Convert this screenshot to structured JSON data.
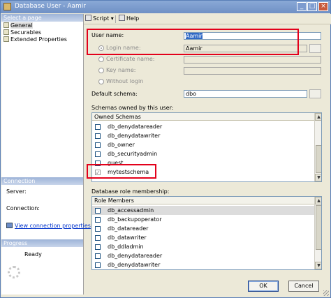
{
  "window": {
    "title": "Database User - Aamir"
  },
  "left": {
    "select_page_header": "Select a page",
    "pages": [
      {
        "label": "General",
        "selected": true
      },
      {
        "label": "Securables",
        "selected": false
      },
      {
        "label": "Extended Properties",
        "selected": false
      }
    ],
    "connection_header": "Connection",
    "server_label": "Server:",
    "connection_label": "Connection:",
    "view_connection_link": "View connection properties",
    "progress_header": "Progress",
    "progress_status": "Ready"
  },
  "toolbar": {
    "script_label": "Script",
    "help_label": "Help"
  },
  "form": {
    "user_name_label": "User name:",
    "user_name_value": "Aamir",
    "login_name_label": "Login name:",
    "login_name_value": "Aamir",
    "certificate_name_label": "Certificate name:",
    "key_name_label": "Key name:",
    "without_login_label": "Without login",
    "default_schema_label": "Default schema:",
    "default_schema_value": "dbo",
    "schemas_section_label": "Schemas owned by this user:",
    "owned_schemas_header": "Owned Schemas",
    "schemas": [
      {
        "name": "db_denydatareader",
        "checked": false
      },
      {
        "name": "db_denydatawriter",
        "checked": false
      },
      {
        "name": "db_owner",
        "checked": false
      },
      {
        "name": "db_securityadmin",
        "checked": false
      },
      {
        "name": "guest",
        "checked": false
      },
      {
        "name": "mytestschema",
        "checked": true
      }
    ],
    "roles_section_label": "Database role membership:",
    "role_members_header": "Role Members",
    "roles": [
      {
        "name": "db_accessadmin",
        "checked": false
      },
      {
        "name": "db_backupoperator",
        "checked": false
      },
      {
        "name": "db_datareader",
        "checked": false
      },
      {
        "name": "db_datawriter",
        "checked": false
      },
      {
        "name": "db_ddladmin",
        "checked": false
      },
      {
        "name": "db_denydatareader",
        "checked": false
      },
      {
        "name": "db_denydatawriter",
        "checked": false
      }
    ]
  },
  "buttons": {
    "ok_label": "OK",
    "cancel_label": "Cancel"
  },
  "colors": {
    "highlight": "#e3001b",
    "selection": "#316ac5"
  }
}
